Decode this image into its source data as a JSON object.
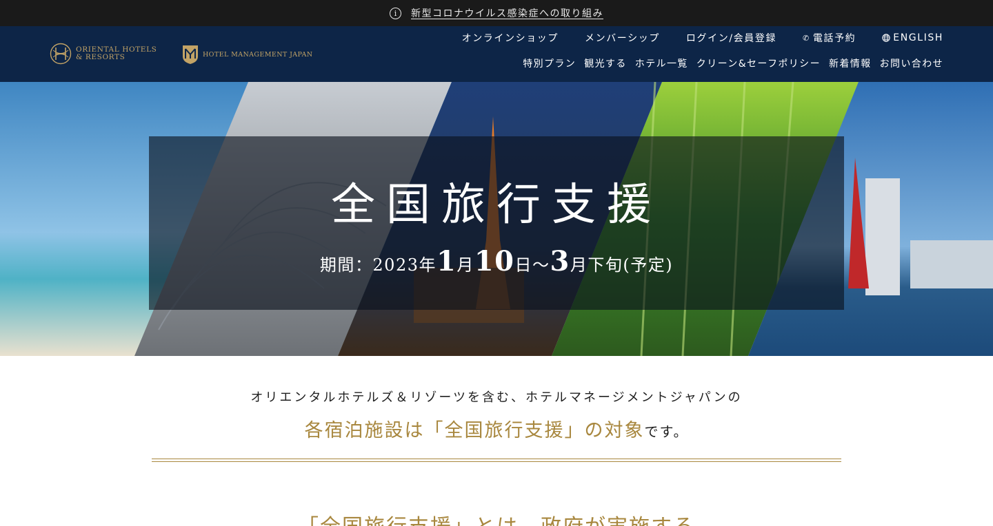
{
  "notice": {
    "icon": "info-icon",
    "link_label": "新型コロナウイルス感染症への取り組み"
  },
  "header": {
    "logo_oriental_line1": "ORIENTAL HOTELS",
    "logo_oriental_line2": "& RESORTS",
    "logo_hmj": "HOTEL MANAGEMENT JAPAN",
    "nav_top": [
      {
        "label": "オンラインショップ"
      },
      {
        "label": "メンバーシップ"
      },
      {
        "label": "ログイン/会員登録"
      },
      {
        "label": "電話予約",
        "icon": "phone-icon"
      },
      {
        "label": "ENGLISH",
        "icon": "globe-icon"
      }
    ],
    "nav_bottom": [
      {
        "label": "特別プラン"
      },
      {
        "label": "観光する"
      },
      {
        "label": "ホテル一覧"
      },
      {
        "label": "クリーン&セーフポリシー"
      },
      {
        "label": "新着情報"
      },
      {
        "label": "お問い合わせ"
      }
    ]
  },
  "hero": {
    "title": "全国旅行支援",
    "period_label": "期間：2023年",
    "period_m1": "1",
    "period_u1": "月",
    "period_d1": "10",
    "period_u2": "日～",
    "period_m2": "3",
    "period_u3": "月下旬(予定)"
  },
  "intro": {
    "line1": "オリエンタルホテルズ＆リゾーツを含む、ホテルマネージメントジャパンの",
    "line2_gold": "各宿泊施設は「全国旅行支援」の対象",
    "line2_tail": "です。",
    "line3": "「全国旅行支援」とは、政府が実施する"
  },
  "colors": {
    "notice_bg": "#1a1a1a",
    "header_bg": "#0d2547",
    "gold": "#a8873e",
    "logo_gold": "#c2a366"
  }
}
